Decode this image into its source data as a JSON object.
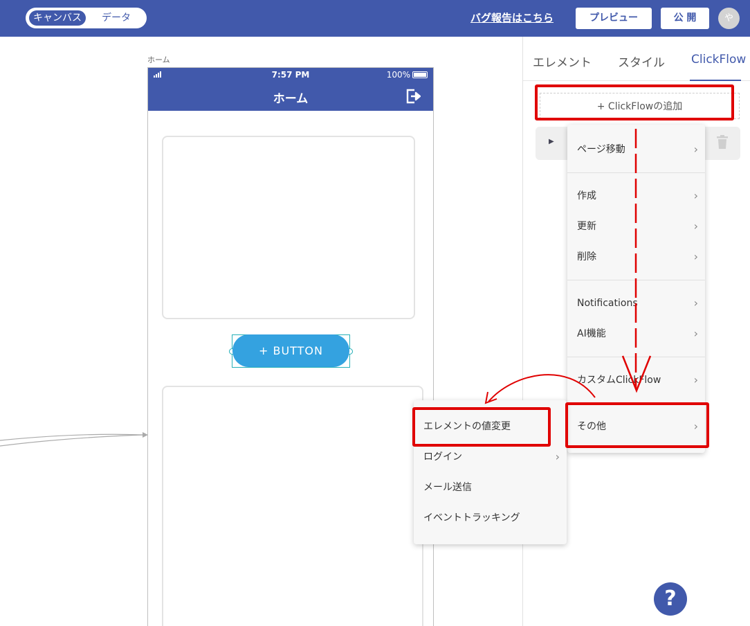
{
  "topbar": {
    "mode_canvas": "キャンバス",
    "mode_data": "データ",
    "bug_report": "バグ報告はこちら",
    "preview_label": "プレビュー",
    "publish_label": "公 開",
    "avatar_initial": "や",
    "brand_color": "#4159ab"
  },
  "canvas": {
    "page_label": "ホーム",
    "phone": {
      "time": "7:57 PM",
      "battery": "100%",
      "title": "ホーム",
      "button_label": "+   BUTTON"
    }
  },
  "panel": {
    "tabs": [
      {
        "label": "エレメント"
      },
      {
        "label": "スタイル"
      },
      {
        "label": "ClickFlow"
      }
    ],
    "add_flow_label": "+  ClickFlowの追加",
    "help_label": "?"
  },
  "menu_main": {
    "items": [
      {
        "label": "ページ移動"
      },
      {
        "label": "作成"
      },
      {
        "label": "更新"
      },
      {
        "label": "削除"
      },
      {
        "label": "Notifications"
      },
      {
        "label": "AI機能"
      },
      {
        "label": "カスタムClickFlow"
      },
      {
        "label": "その他"
      }
    ]
  },
  "menu_sub": {
    "items": [
      {
        "label": "エレメントの値変更"
      },
      {
        "label": "ログイン"
      },
      {
        "label": "メール送信"
      },
      {
        "label": "イベントトラッキング"
      }
    ]
  },
  "annotation_color": "#e00000"
}
